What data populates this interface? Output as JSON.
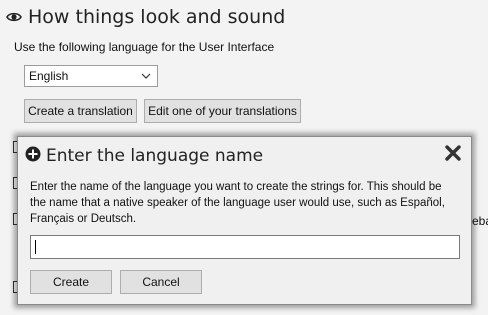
{
  "header": {
    "title": "How things look and sound",
    "icon": "eye-icon"
  },
  "language": {
    "label": "Use the following language for the User Interface",
    "selected": "English"
  },
  "buttons": {
    "create_translation": "Create a translation",
    "edit_translations": "Edit one of your translations"
  },
  "background": {
    "partial_text": "eba"
  },
  "dialog": {
    "title": "Enter the language name",
    "description": "Enter the name of the language you want to create the strings for. This should be the name that a native speaker of the language user would use, such as Español, Français or Deutsch.",
    "input_value": "",
    "create_label": "Create",
    "cancel_label": "Cancel"
  },
  "colors": {
    "background": "#f3f3f3",
    "button": "#e1e1e1",
    "dialog": "#f0f0f0"
  }
}
